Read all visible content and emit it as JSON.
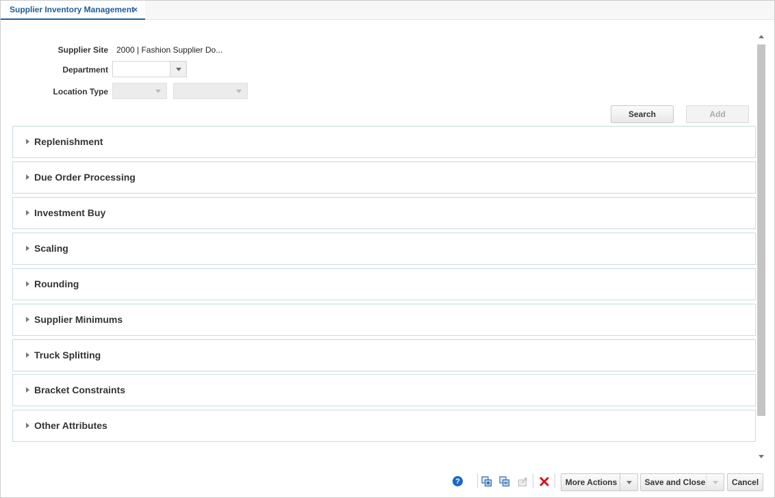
{
  "tab": {
    "label": "Supplier Inventory Management",
    "close": "×"
  },
  "form": {
    "supplier_site_label": "Supplier Site",
    "supplier_site_value": "2000 | Fashion Supplier Do...",
    "department_label": "Department",
    "department_value": "",
    "location_type_label": "Location Type",
    "location_type_value": "",
    "location_value": ""
  },
  "buttons": {
    "search": "Search",
    "add": "Add"
  },
  "sections": [
    {
      "title": "Replenishment"
    },
    {
      "title": "Due Order Processing"
    },
    {
      "title": "Investment Buy"
    },
    {
      "title": "Scaling"
    },
    {
      "title": "Rounding"
    },
    {
      "title": "Supplier Minimums"
    },
    {
      "title": "Truck Splitting"
    },
    {
      "title": "Bracket Constraints"
    },
    {
      "title": "Other Attributes"
    }
  ],
  "footer": {
    "help": "?",
    "more_actions": "More Actions",
    "save_and_close": "Save and Close",
    "cancel": "Cancel"
  },
  "icons": {
    "help": "help-icon",
    "copy": "duplicate-icon",
    "copy_alt": "duplicate-alt-icon",
    "export": "export-icon",
    "delete": "delete-icon"
  },
  "colors": {
    "accent": "#1f5c99",
    "section_border": "#c6dbe0",
    "delete": "#d0121b"
  }
}
